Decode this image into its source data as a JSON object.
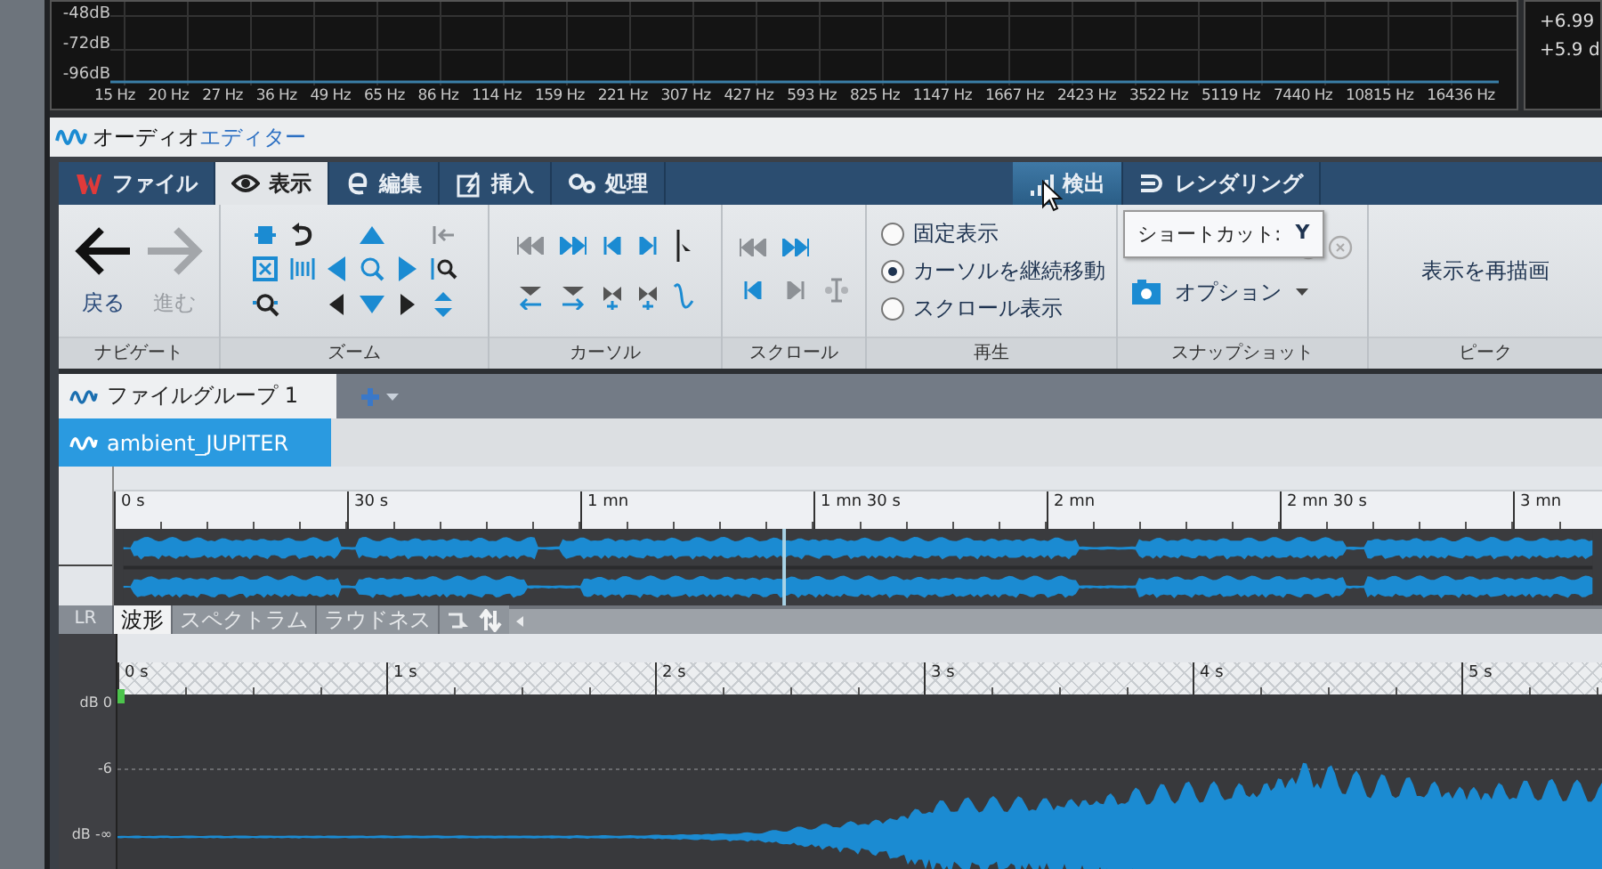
{
  "spectrum": {
    "y_labels": [
      "-48dB",
      "-72dB",
      "-96dB"
    ],
    "x_labels": [
      "15 Hz",
      "20 Hz",
      "27 Hz",
      "36 Hz",
      "49 Hz",
      "65 Hz",
      "86 Hz",
      "114 Hz",
      "159 Hz",
      "221 Hz",
      "307 Hz",
      "427 Hz",
      "593 Hz",
      "825 Hz",
      "1147 Hz",
      "1667 Hz",
      "2423 Hz",
      "3522 Hz",
      "5119 Hz",
      "7440 Hz",
      "10815 Hz",
      "16436 Hz"
    ],
    "readouts": [
      "+6.99",
      "+5.9 d"
    ]
  },
  "window": {
    "title_main": "オーディオ",
    "title_accent": "エディター"
  },
  "ribbon_tabs": [
    {
      "label": "ファイル",
      "kind": "app",
      "selected": false,
      "hovered": false
    },
    {
      "label": "表示",
      "kind": "view",
      "selected": true,
      "hovered": false
    },
    {
      "label": "編集",
      "kind": "edit",
      "selected": false,
      "hovered": false
    },
    {
      "label": "挿入",
      "kind": "insert",
      "selected": false,
      "hovered": false
    },
    {
      "label": "処理",
      "kind": "process",
      "selected": false,
      "hovered": false
    }
  ],
  "ribbon_tabs_2": [
    {
      "label": "検出",
      "kind": "detect",
      "selected": false,
      "hovered": true
    },
    {
      "label": "レンダリング",
      "kind": "render",
      "selected": false,
      "hovered": false
    }
  ],
  "navigate": {
    "caption": "ナビゲート",
    "buttons": [
      {
        "label": "戻る",
        "disabled": false
      },
      {
        "label": "進む",
        "disabled": true
      }
    ]
  },
  "zoom": {
    "caption": "ズーム"
  },
  "cursor": {
    "caption": "カーソル"
  },
  "scroll": {
    "caption": "スクロール"
  },
  "playback": {
    "caption": "再生",
    "options": [
      {
        "label": "固定表示",
        "selected": false
      },
      {
        "label": "カーソルを継続移動",
        "selected": true
      },
      {
        "label": "スクロール表示",
        "selected": false
      }
    ]
  },
  "snapshot": {
    "caption": "スナップショット",
    "option_button": "オプション"
  },
  "peak": {
    "caption": "ピーク",
    "button": "表示を再描画"
  },
  "tooltip": {
    "label": "ショートカット:",
    "key": "Y"
  },
  "file_groups": {
    "tabs": [
      {
        "label": "ファイルグループ 1",
        "selected": true
      }
    ]
  },
  "files": {
    "tabs": [
      {
        "label": "ambient_JUPITER",
        "selected": true
      }
    ]
  },
  "overview": {
    "ruler": [
      "0 s",
      "30 s",
      "1 mn",
      "1 mn 30 s",
      "2 mn",
      "2 mn 30 s",
      "3 mn"
    ]
  },
  "view_tabs": {
    "channel": "LR",
    "tabs": [
      {
        "label": "波形",
        "selected": true
      },
      {
        "label": "スペクトラム",
        "selected": false
      },
      {
        "label": "ラウドネス",
        "selected": false
      }
    ]
  },
  "main_view": {
    "ruler": [
      "0 s",
      "1 s",
      "2 s",
      "3 s",
      "4 s",
      "5 s"
    ],
    "db_labels": [
      "dB 0",
      "-6",
      "dB -∞"
    ]
  }
}
